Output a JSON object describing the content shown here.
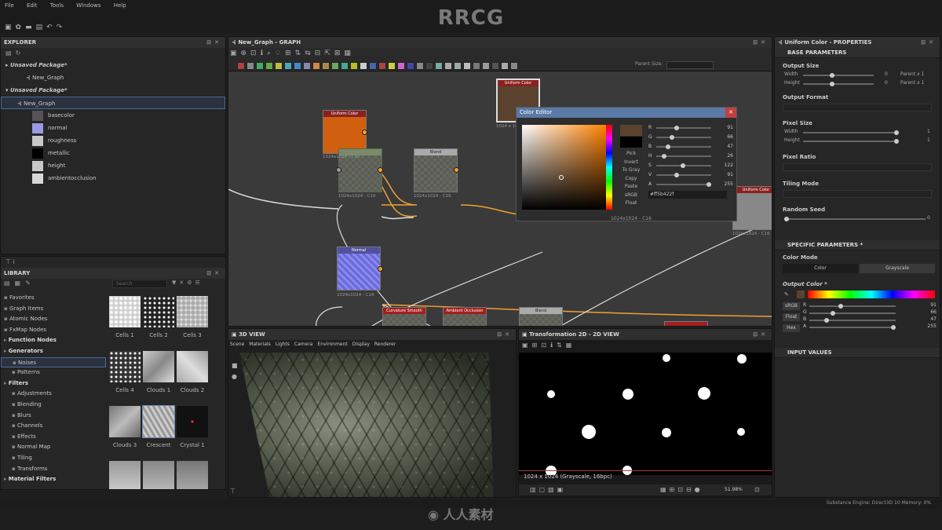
{
  "brand": "RRCG",
  "menu": [
    "File",
    "Edit",
    "Tools",
    "Windows",
    "Help"
  ],
  "explorer": {
    "title": "EXPLORER",
    "packages": [
      {
        "name": "Unsaved Package*",
        "graph": "New_Graph"
      },
      {
        "name": "Unsaved Package*",
        "graph": "New_Graph"
      }
    ],
    "outputs": [
      {
        "label": "basecolor",
        "color": "#555555"
      },
      {
        "label": "normal",
        "color": "#9a9ae6"
      },
      {
        "label": "roughness",
        "color": "#c8c8c8"
      },
      {
        "label": "metallic",
        "color": "#000000"
      },
      {
        "label": "height",
        "color": "#c8c8c8"
      },
      {
        "label": "ambientocclusion",
        "color": "#d8d8d8"
      }
    ]
  },
  "library": {
    "title": "LIBRARY",
    "search_placeholder": "Search",
    "tree": [
      {
        "label": "Favorites",
        "bold": false
      },
      {
        "label": "Graph Items",
        "bold": false
      },
      {
        "label": "Atomic Nodes",
        "bold": false
      },
      {
        "label": "FxMap Nodes",
        "bold": false
      },
      {
        "label": "Function Nodes",
        "bold": true
      },
      {
        "label": "Generators",
        "bold": true
      },
      {
        "label": "Noises",
        "bold": false
      },
      {
        "label": "Patterns",
        "bold": false
      },
      {
        "label": "Filters",
        "bold": true
      },
      {
        "label": "Adjustments",
        "bold": false
      },
      {
        "label": "Blending",
        "bold": false
      },
      {
        "label": "Blurs",
        "bold": false
      },
      {
        "label": "Channels",
        "bold": false
      },
      {
        "label": "Effects",
        "bold": false
      },
      {
        "label": "Normal Map",
        "bold": false
      },
      {
        "label": "Tiling",
        "bold": false
      },
      {
        "label": "Transforms",
        "bold": false
      },
      {
        "label": "Material Filters",
        "bold": true
      }
    ],
    "thumbs": [
      "Cells 1",
      "Cells 2",
      "Cells 3",
      "Cells 4",
      "Clouds 1",
      "Clouds 2",
      "Clouds 3",
      "Crescent",
      "Crystal 1",
      "",
      "",
      ""
    ]
  },
  "graph": {
    "title": "New_Graph - GRAPH",
    "parent_size_label": "Parent Size:",
    "nodes": {
      "uniform1": {
        "title": "Uniform Color",
        "size": "1024x1024 - C16"
      },
      "uniform2": {
        "title": "Uniform Color",
        "size": "1024 x 1024 - C16"
      },
      "uniform3": {
        "title": "Uniform Color",
        "size": "1024x1024 - C16"
      },
      "blend": {
        "title": "Blend",
        "size": "1024x1024 - C16"
      },
      "normal": {
        "title": "Normal",
        "size": "1024x1024 - C16"
      },
      "mid": {
        "title": "",
        "size": "1024x1024 - C16"
      },
      "b1": {
        "title": "Curvature Smooth"
      },
      "b2": {
        "title": "Ambient Occlusion"
      },
      "b3": {
        "title": "Blend"
      }
    }
  },
  "color_editor": {
    "title": "Color Editor",
    "buttons": [
      "Pick",
      "Invert",
      "To Gray",
      "Copy",
      "Paste",
      "sRGB",
      "Float"
    ],
    "channels": [
      {
        "k": "R",
        "v": "91"
      },
      {
        "k": "G",
        "v": "66"
      },
      {
        "k": "B",
        "v": "47"
      },
      {
        "k": "H",
        "v": "26"
      },
      {
        "k": "S",
        "v": "122"
      },
      {
        "k": "V",
        "v": "91"
      },
      {
        "k": "A",
        "v": "255"
      }
    ],
    "hex": "#ff5b422f",
    "footer": "1024x1024 - C16"
  },
  "properties": {
    "title": "Uniform Color - PROPERTIES",
    "base_parameters": "BASE PARAMETERS",
    "output_size": "Output Size",
    "width": "Width",
    "height": "Height",
    "width_val": "0",
    "height_val": "0",
    "width_rel": "Parent x 1",
    "height_rel": "Parent x 1",
    "output_format": "Output Format",
    "pixel_size": "Pixel Size",
    "px_width_val": "1",
    "px_height_val": "1",
    "pixel_ratio": "Pixel Ratio",
    "tiling_mode": "Tiling Mode",
    "random_seed": "Random Seed",
    "seed_val": "0",
    "specific_parameters": "SPECIFIC PARAMETERS *",
    "color_mode": "Color Mode",
    "color_mode_options": [
      "Color",
      "Grayscale"
    ],
    "output_color": "Output Color *",
    "srgb": "sRGB",
    "float": "Float",
    "hex_btn": "Hex",
    "rgba": [
      {
        "k": "R",
        "v": "91"
      },
      {
        "k": "G",
        "v": "66"
      },
      {
        "k": "B",
        "v": "47"
      },
      {
        "k": "A",
        "v": "255"
      }
    ],
    "input_values": "INPUT VALUES",
    "accent_color": "#5b422f"
  },
  "view3d": {
    "title": "3D VIEW",
    "menu": [
      "Scene",
      "Materials",
      "Lights",
      "Camera",
      "Environment",
      "Display",
      "Renderer"
    ]
  },
  "view2d": {
    "title": "Transformation 2D - 2D VIEW",
    "status": "1024 x 1024 (Grayscale, 16bpc)",
    "zoom": "51.98%"
  },
  "statusbar": {
    "text": "Substance Engine: Direct3D 10  Memory: 0%"
  },
  "watermark": {
    "brand": "人人素材"
  }
}
